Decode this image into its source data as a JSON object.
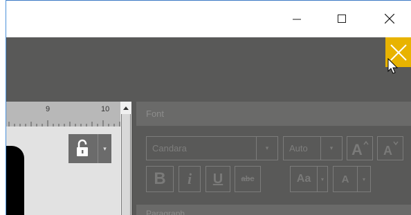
{
  "window": {
    "minimize_icon": "minimize-icon",
    "maximize_icon": "maximize-icon",
    "close_icon": "close-icon"
  },
  "app": {
    "close_icon": "close-icon",
    "accent_color": "#e8b300"
  },
  "ruler": {
    "labels": [
      "9",
      "10"
    ]
  },
  "font_panel": {
    "header": "Font",
    "font_name": "Candara",
    "font_size": "Auto",
    "grow_icon": "grow-font-icon",
    "shrink_icon": "shrink-font-icon",
    "bold_label": "B",
    "italic_label": "i",
    "underline_label": "U",
    "strike_label": "abc",
    "case_label": "Aa",
    "color_label": "A"
  },
  "paragraph_panel": {
    "header": "Paragraph"
  }
}
